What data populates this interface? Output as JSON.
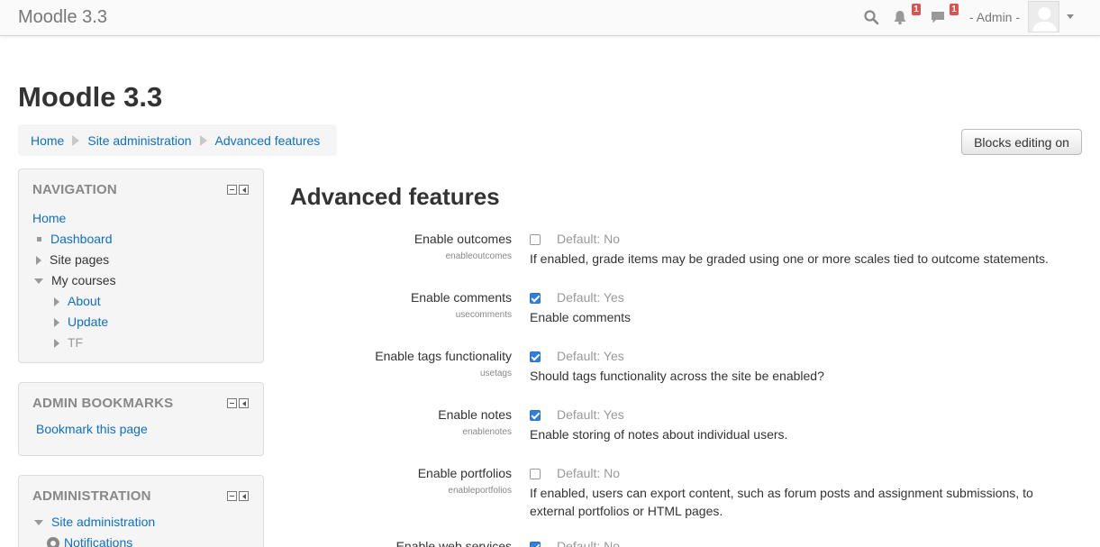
{
  "navbar": {
    "brand": "Moodle 3.3",
    "notifications_count": "1",
    "messages_count": "1",
    "user_name": "- Admin -"
  },
  "header": {
    "title": "Moodle 3.3",
    "breadcrumb": [
      "Home",
      "Site administration",
      "Advanced features"
    ],
    "blocks_editing_button": "Blocks editing on"
  },
  "navigation_block": {
    "title": "NAVIGATION",
    "home": "Home",
    "dashboard": "Dashboard",
    "site_pages": "Site pages",
    "my_courses": "My courses",
    "courses": [
      "About",
      "Update",
      "TF"
    ]
  },
  "bookmarks_block": {
    "title": "ADMIN BOOKMARKS",
    "link": "Bookmark this page"
  },
  "admin_block": {
    "title": "ADMINISTRATION",
    "site_administration": "Site administration",
    "notifications": "Notifications"
  },
  "main": {
    "title": "Advanced features",
    "settings": [
      {
        "label": "Enable outcomes",
        "key": "enableoutcomes",
        "checked": false,
        "default": "Default: No",
        "description": "If enabled, grade items may be graded using one or more scales tied to outcome statements."
      },
      {
        "label": "Enable comments",
        "key": "usecomments",
        "checked": true,
        "default": "Default: Yes",
        "description": "Enable comments"
      },
      {
        "label": "Enable tags functionality",
        "key": "usetags",
        "checked": true,
        "default": "Default: Yes",
        "description": "Should tags functionality across the site be enabled?"
      },
      {
        "label": "Enable notes",
        "key": "enablenotes",
        "checked": true,
        "default": "Default: Yes",
        "description": "Enable storing of notes about individual users."
      },
      {
        "label": "Enable portfolios",
        "key": "enableportfolios",
        "checked": false,
        "default": "Default: No",
        "description": "If enabled, users can export content, such as forum posts and assignment submissions, to external portfolios or HTML pages."
      },
      {
        "label": "Enable web services",
        "key": "enablewebservices",
        "checked": true,
        "default": "Default: No",
        "description": ""
      }
    ]
  },
  "colors": {
    "link": "#0f6fc5",
    "badge": "#d9534f",
    "checkbox_on": "#2f7fe0"
  }
}
